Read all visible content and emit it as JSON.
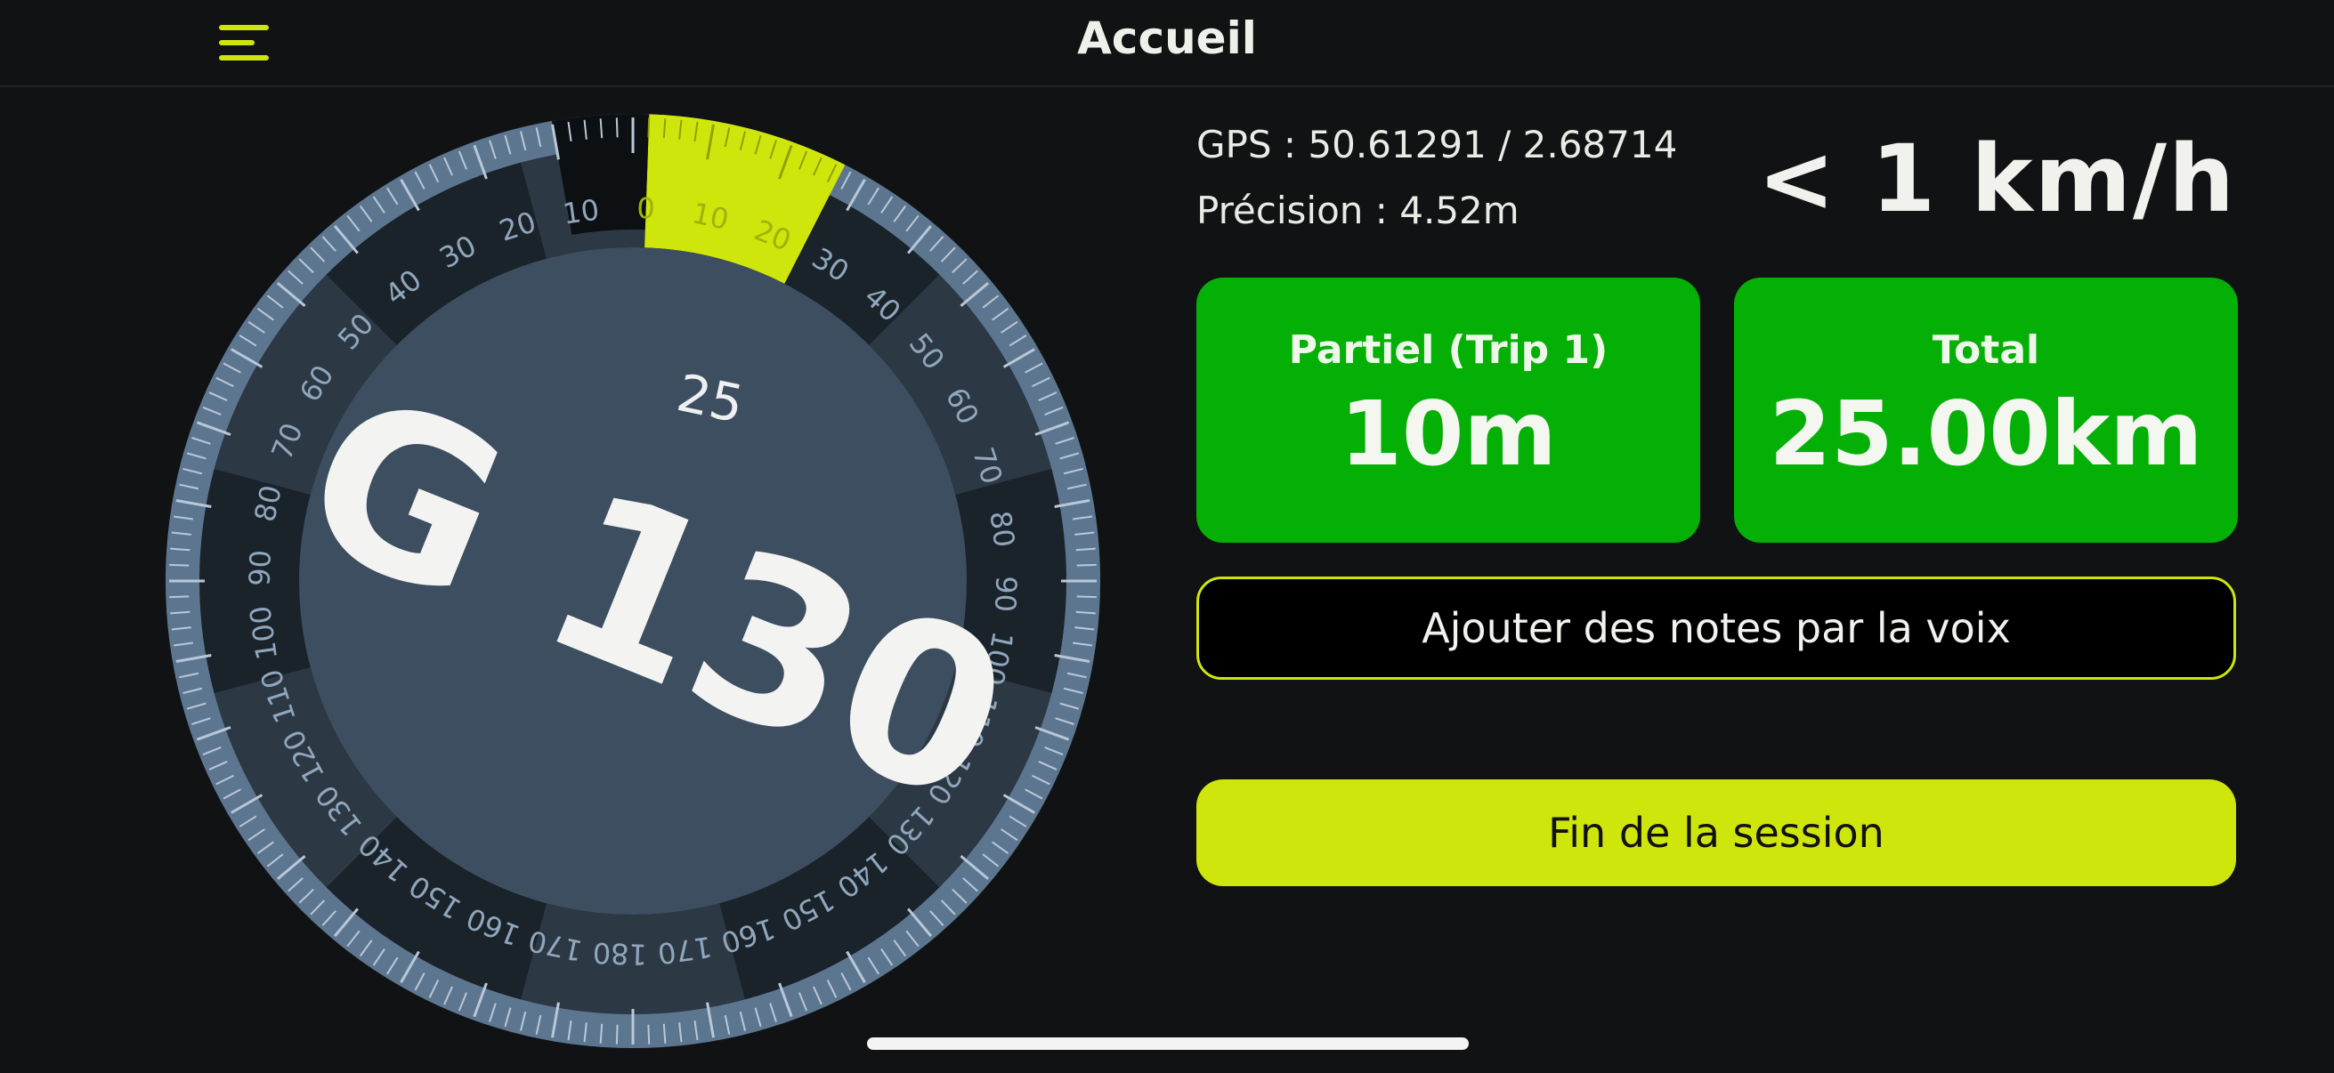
{
  "header": {
    "title": "Accueil",
    "menu_icon": "hamburger-menu-icon"
  },
  "gps": {
    "text": "GPS :  50.61291 / 2.68714"
  },
  "precision": {
    "text": "Précision : 4.52m"
  },
  "speed": {
    "text": "< 1 km/h"
  },
  "cards": {
    "partial": {
      "label": "Partiel  (Trip 1)",
      "value": "10m"
    },
    "total": {
      "label": "Total",
      "value": "25.00km"
    }
  },
  "buttons": {
    "voice_notes": "Ajouter des notes par la voix",
    "end_session": "Fin de la session"
  },
  "dial": {
    "road": "G 130",
    "small_value": "25",
    "right_labels": [
      "0",
      "10",
      "20",
      "30",
      "40",
      "50",
      "60",
      "70",
      "80",
      "90",
      "100",
      "110",
      "120",
      "130",
      "140",
      "150",
      "160",
      "170",
      "180"
    ],
    "left_labels": [
      "10",
      "20",
      "30",
      "40",
      "50",
      "60",
      "70",
      "80",
      "90",
      "100",
      "110",
      "120",
      "130",
      "140",
      "150",
      "160",
      "170"
    ],
    "highlight_value": 25
  },
  "colors": {
    "accent": "#cfe60c",
    "card_green": "#04b006",
    "background": "#111213",
    "dial_center": "#3d4e61"
  }
}
